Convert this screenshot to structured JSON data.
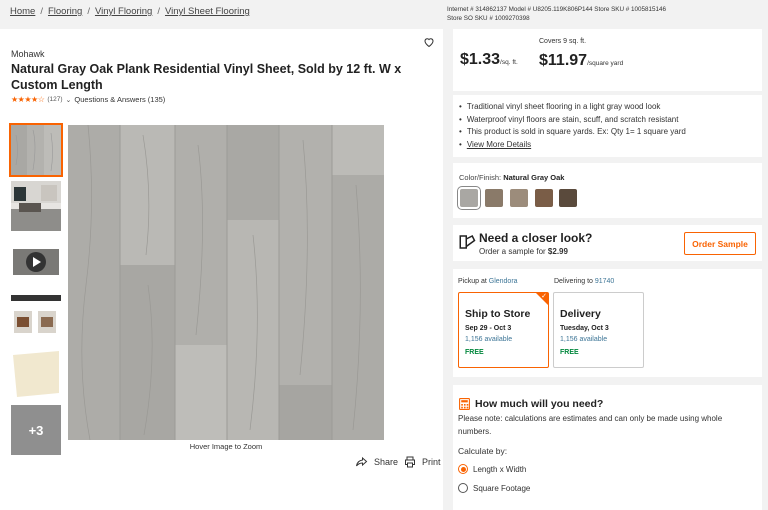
{
  "breadcrumb": [
    "Home",
    "Flooring",
    "Vinyl Flooring",
    "Vinyl Sheet Flooring"
  ],
  "ids": {
    "line1": "Internet # 314862137   Model # U8205.119K806P144   Store SKU # 1005815146",
    "line2": "Store SO SKU # 1009270398"
  },
  "product": {
    "brand": "Mohawk",
    "title": "Natural Gray Oak Plank Residential Vinyl Sheet, Sold by 12 ft. W x Custom Length",
    "stars": "★★★★☆",
    "rating_count": "(127)",
    "qa": "Questions & Answers (135)",
    "more_images": "+3",
    "hover_text": "Hover Image to Zoom",
    "share": "Share",
    "print": "Print"
  },
  "price": {
    "covers": "Covers 9 sq. ft.",
    "per_sqft": "$1.33",
    "per_sqft_unit": "/sq. ft.",
    "per_yard": "$11.97",
    "per_yard_unit": "/square yard"
  },
  "bullets": [
    "Traditional vinyl sheet flooring in a light gray wood look",
    "Waterproof vinyl floors are stain, scuff, and scratch resistant",
    "This product is sold in square yards. Ex: Qty 1= 1 square yard",
    "View More Details"
  ],
  "color": {
    "label": "Color/Finish:",
    "value": "Natural Gray Oak",
    "swatches": [
      "#a9a7a3",
      "#8a7a69",
      "#9c8c7b",
      "#7a5d47",
      "#5a4a3c"
    ]
  },
  "closer": {
    "heading": "Need a closer look?",
    "sub_prefix": "Order a sample for ",
    "sub_price": "$2.99",
    "button": "Order Sample"
  },
  "fulfillment": {
    "pickup_label": "Pickup at ",
    "pickup_store": "Glendora",
    "delivery_label": "Delivering to ",
    "delivery_zip": "91740",
    "ship": {
      "title": "Ship to Store",
      "dates": "Sep 29 - Oct 3",
      "avail": "1,156 available",
      "cost": "FREE"
    },
    "delivery": {
      "title": "Delivery",
      "dates": "Tuesday, Oct 3",
      "avail": "1,156 available",
      "cost": "FREE"
    }
  },
  "calculator": {
    "heading": "How much will you need?",
    "note": "Please note: calculations are estimates and can only be made using whole numbers.",
    "calc_by": "Calculate by:",
    "option1": "Length x Width",
    "option2": "Square Footage"
  },
  "colors": {
    "accent": "#f96302",
    "link": "#3e7697",
    "free": "#00873c"
  }
}
